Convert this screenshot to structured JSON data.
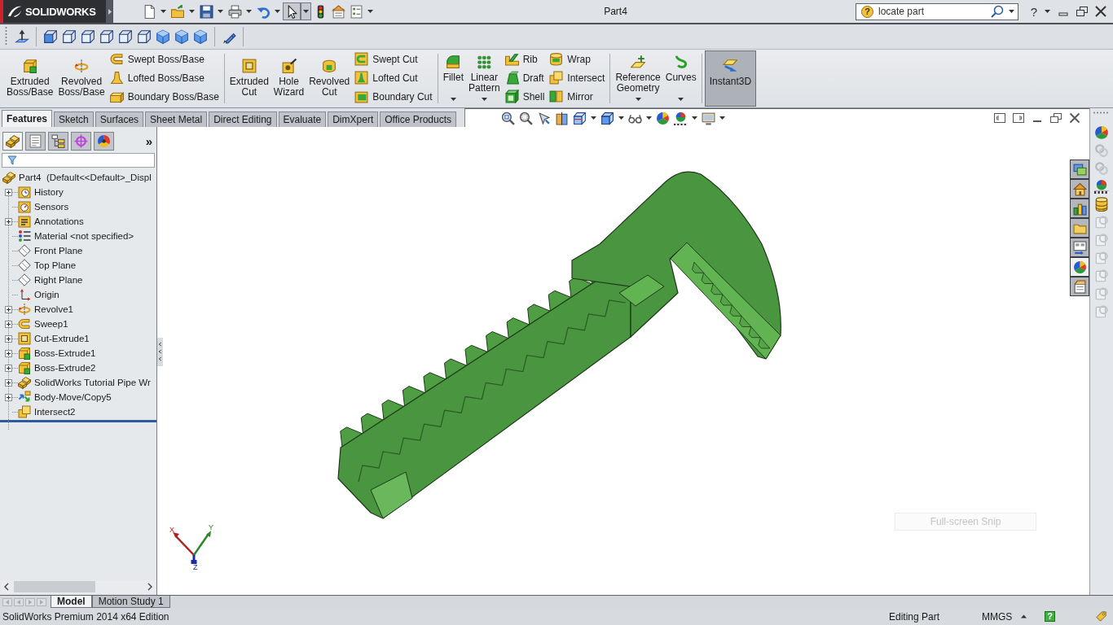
{
  "title_bar": {
    "logo": "SOLIDWORKS",
    "quick_access": [
      {
        "kind": "new",
        "dropdown": true,
        "pressed": false
      },
      {
        "kind": "open",
        "dropdown": true,
        "pressed": false
      },
      {
        "kind": "save",
        "dropdown": true,
        "pressed": false
      },
      {
        "kind": "print",
        "dropdown": true,
        "pressed": false
      },
      {
        "kind": "undo",
        "dropdown": true,
        "pressed": false
      },
      {
        "kind": "select",
        "dropdown": true,
        "pressed": true
      },
      {
        "kind": "rebuild",
        "dropdown": false,
        "pressed": false
      },
      {
        "kind": "properties",
        "dropdown": false,
        "pressed": false
      },
      {
        "kind": "options",
        "dropdown": true,
        "pressed": false
      }
    ],
    "title": "Part4",
    "search": {
      "badge": "?",
      "value": "locate part"
    },
    "help": "?"
  },
  "command_manager": {
    "groups": [
      {
        "large": [
          {
            "label": "Extruded\nBoss/Base",
            "kind": "extrude",
            "dropdown": false,
            "pressed": false
          },
          {
            "label": "Revolved\nBoss/Base",
            "kind": "revolve",
            "dropdown": false,
            "pressed": false
          }
        ],
        "columns": [
          [
            {
              "label": "Swept Boss/Base",
              "kind": "sweep"
            },
            {
              "label": "Lofted Boss/Base",
              "kind": "loft"
            },
            {
              "label": "Boundary Boss/Base",
              "kind": "boundary"
            }
          ]
        ]
      },
      {
        "large": [
          {
            "label": "Extruded\nCut",
            "kind": "cut-extrude",
            "dropdown": false,
            "pressed": false
          },
          {
            "label": "Hole\nWizard",
            "kind": "hole",
            "dropdown": false,
            "pressed": false
          },
          {
            "label": "Revolved\nCut",
            "kind": "revolve-cut",
            "dropdown": false,
            "pressed": false
          }
        ],
        "columns": [
          [
            {
              "label": "Swept Cut",
              "kind": "sweep-cut"
            },
            {
              "label": "Lofted Cut",
              "kind": "loft-cut"
            },
            {
              "label": "Boundary Cut",
              "kind": "boundary-cut"
            }
          ]
        ]
      },
      {
        "large": [
          {
            "label": "Fillet",
            "kind": "fillet",
            "dropdown": true,
            "pressed": false
          },
          {
            "label": "Linear\nPattern",
            "kind": "pattern",
            "dropdown": true,
            "pressed": false
          }
        ],
        "columns": [
          [
            {
              "label": "Rib",
              "kind": "rib"
            },
            {
              "label": "Draft",
              "kind": "draft"
            },
            {
              "label": "Shell",
              "kind": "shell"
            }
          ],
          [
            {
              "label": "Wrap",
              "kind": "wrap"
            },
            {
              "label": "Intersect",
              "kind": "intersect"
            },
            {
              "label": "Mirror",
              "kind": "mirror"
            }
          ]
        ]
      },
      {
        "large": [
          {
            "label": "Reference\nGeometry",
            "kind": "refgeom",
            "dropdown": true,
            "pressed": false
          },
          {
            "label": "Curves",
            "kind": "curves",
            "dropdown": true,
            "pressed": false
          }
        ]
      },
      {
        "large": [
          {
            "label": "Instant3D",
            "kind": "instant3d",
            "dropdown": false,
            "pressed": true
          }
        ]
      }
    ]
  },
  "feature_tabs": [
    {
      "label": "Features",
      "selected": true
    },
    {
      "label": "Sketch",
      "selected": false
    },
    {
      "label": "Surfaces",
      "selected": false
    },
    {
      "label": "Sheet Metal",
      "selected": false
    },
    {
      "label": "Direct Editing",
      "selected": false
    },
    {
      "label": "Evaluate",
      "selected": false
    },
    {
      "label": "DimXpert",
      "selected": false
    },
    {
      "label": "Office Products",
      "selected": false
    }
  ],
  "manager_panel": {
    "tabs": [
      {
        "kind": "feature-tree",
        "selected": true
      },
      {
        "kind": "property",
        "selected": false
      },
      {
        "kind": "config",
        "selected": false
      },
      {
        "kind": "dimxpert",
        "selected": false
      },
      {
        "kind": "display",
        "selected": false
      }
    ],
    "more": "»",
    "tree": {
      "label": "Part4  (Default<<Default>_Displ",
      "kind": "part",
      "children": [
        {
          "label": "History",
          "kind": "history",
          "expandable": true
        },
        {
          "label": "Sensors",
          "kind": "sensors",
          "expandable": false
        },
        {
          "label": "Annotations",
          "kind": "annotations",
          "expandable": true
        },
        {
          "label": "Material <not specified>",
          "kind": "material",
          "expandable": false
        },
        {
          "label": "Front Plane",
          "kind": "plane",
          "expandable": false
        },
        {
          "label": "Top Plane",
          "kind": "plane",
          "expandable": false
        },
        {
          "label": "Right Plane",
          "kind": "plane",
          "expandable": false
        },
        {
          "label": "Origin",
          "kind": "origin",
          "expandable": false
        },
        {
          "label": "Revolve1",
          "kind": "revolve",
          "expandable": true
        },
        {
          "label": "Sweep1",
          "kind": "sweep",
          "expandable": true
        },
        {
          "label": "Cut-Extrude1",
          "kind": "cut-extrude",
          "expandable": true
        },
        {
          "label": "Boss-Extrude1",
          "kind": "boss-extrude",
          "expandable": true
        },
        {
          "label": "Boss-Extrude2",
          "kind": "boss-extrude",
          "expandable": true
        },
        {
          "label": "SolidWorks Tutorial Pipe Wr",
          "kind": "part",
          "expandable": true
        },
        {
          "label": "Body-Move/Copy5",
          "kind": "move-copy",
          "expandable": true
        },
        {
          "label": "Intersect2",
          "kind": "intersect",
          "expandable": false
        }
      ]
    }
  },
  "model_view": {
    "triad": [
      "X",
      "Y",
      "Z"
    ],
    "snip_label": "Full-screen Snip"
  },
  "bottom_tabs": [
    {
      "label": "Model",
      "selected": true
    },
    {
      "label": "Motion Study 1",
      "selected": false
    }
  ],
  "status_bar": {
    "edition": "SolidWorks Premium 2014 x64 Edition",
    "mode": "Editing Part",
    "units": "MMGS",
    "help": "?"
  }
}
